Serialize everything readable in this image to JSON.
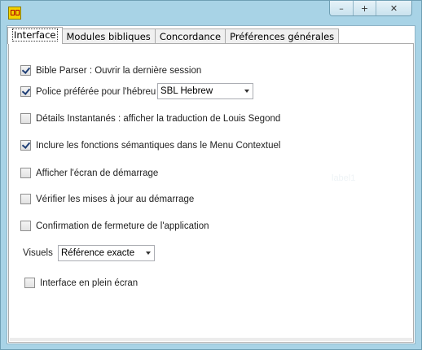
{
  "window": {
    "controls": {
      "minimize": "–",
      "maximize": "+",
      "close": "✕"
    }
  },
  "tabs": [
    {
      "label": "Interface",
      "active": true
    },
    {
      "label": "Modules bibliques"
    },
    {
      "label": "Concordance"
    },
    {
      "label": "Préférences générales"
    }
  ],
  "options": {
    "open_last_session": {
      "label": "Bible Parser : Ouvrir la dernière session",
      "checked": true
    },
    "hebrew_font": {
      "label": "Police préférée pour l'hébreu",
      "checked": true,
      "value": "SBL Hebrew"
    },
    "instant_details": {
      "label": "Détails Instantanés : afficher la traduction de Louis Segond",
      "checked": false
    },
    "semantic_functions": {
      "label": "Inclure les fonctions sémantiques dans le Menu Contextuel",
      "checked": true
    },
    "splash_screen": {
      "label": "Afficher l'écran de démarrage",
      "checked": false
    },
    "check_updates": {
      "label": "Vérifier les mises à jour au démarrage",
      "checked": false
    },
    "exit_confirmation": {
      "label": "Confirmation de fermeture de l'application",
      "checked": false
    },
    "visuals": {
      "label": "Visuels",
      "value": "Référence exacte"
    },
    "fullscreen": {
      "label": "Interface en plein écran",
      "checked": false
    }
  },
  "ghost_label": "label1",
  "icons": {
    "app": "bible-parser-app-icon"
  }
}
